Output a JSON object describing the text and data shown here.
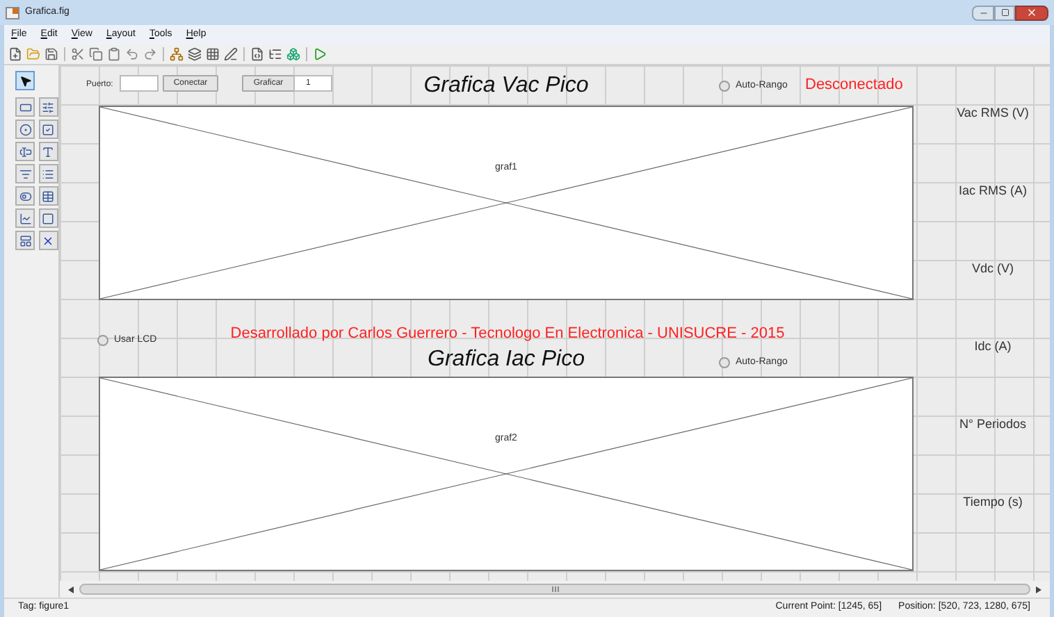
{
  "window": {
    "title": "Grafica.fig"
  },
  "menu": [
    "File",
    "Edit",
    "View",
    "Layout",
    "Tools",
    "Help"
  ],
  "canvas": {
    "port_label": "Puerto:",
    "connect_button": "Conectar",
    "plot_button": "Graficar",
    "count_field": {
      "value": "1"
    },
    "title_top": "Grafica Vac Pico",
    "auto_range_top": {
      "label": "Auto-Rango",
      "checked": false
    },
    "connection_status": "Desconectado",
    "axes_top": {
      "tag": "graf1"
    },
    "lcd_option": {
      "label": "Usar LCD",
      "checked": false
    },
    "credits": "Desarrollado por Carlos Guerrero - Tecnologo En Electronica - UNISUCRE - 2015",
    "title_bottom": "Grafica Iac Pico",
    "auto_range_bottom": {
      "label": "Auto-Rango",
      "checked": false
    },
    "axes_bottom": {
      "tag": "graf2"
    },
    "readouts": [
      "Vac RMS (V)",
      "Iac RMS (A)",
      "Vdc (V)",
      "Idc (A)",
      "N° Periodos",
      "Tiempo (s)"
    ]
  },
  "status_bar": {
    "tag": "Tag: figure1",
    "current_point": "Current Point: [1245, 65]",
    "position": "Position: [520, 723, 1280, 675]"
  }
}
